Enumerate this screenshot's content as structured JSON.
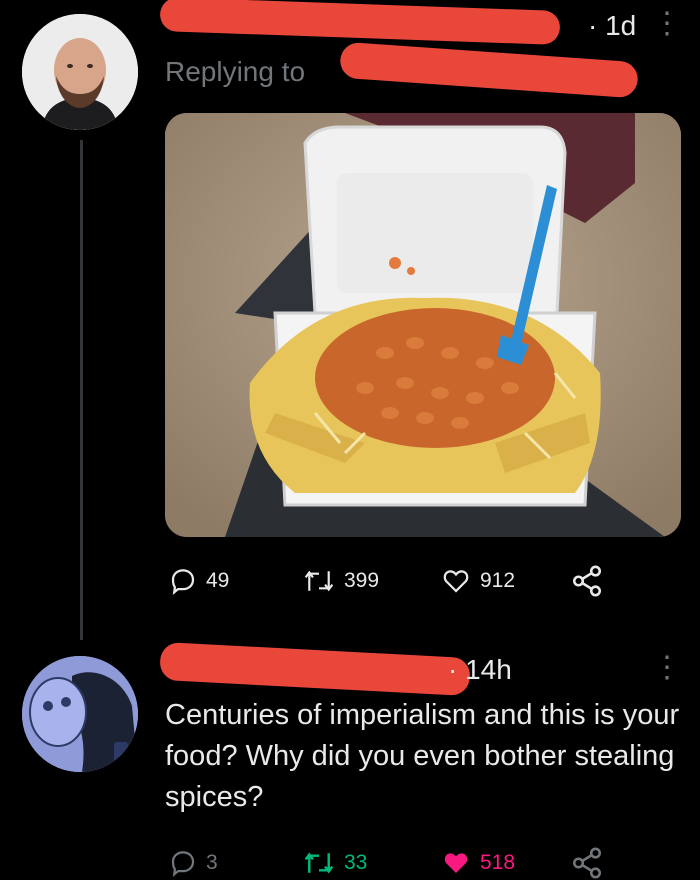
{
  "tweet1": {
    "time": "· 1d",
    "replying_prefix": "Replying to",
    "stats": {
      "replies": "49",
      "retweets": "399",
      "likes": "912"
    }
  },
  "tweet2": {
    "time": "· 14h",
    "text": "Centuries of imperialism and this is your food? Why did you even bother stealing spices?",
    "stats": {
      "replies": "3",
      "retweets": "33",
      "likes": "518"
    }
  },
  "colors": {
    "retweet_active": "#00ba7c",
    "like_active": "#f91880",
    "redaction": "#e8473a"
  }
}
